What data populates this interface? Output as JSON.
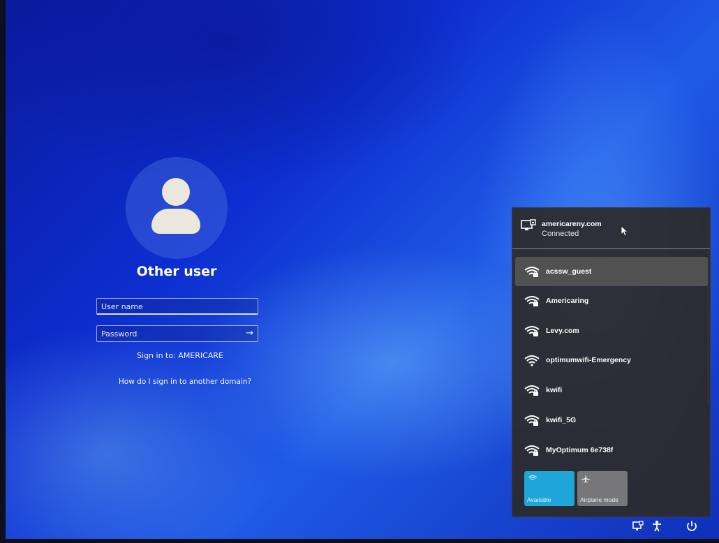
{
  "login": {
    "title": "Other user",
    "username_placeholder": "User name",
    "password_placeholder": "Password",
    "sign_in_to": "Sign in to: AMERICARE",
    "domain_help": "How do I sign in to another domain?"
  },
  "network_flyout": {
    "connected": {
      "name": "americareny.com",
      "status": "Connected",
      "icon": "ethernet-icon"
    },
    "networks": [
      {
        "name": "acssw_guest",
        "icon": "wifi-secured-icon"
      },
      {
        "name": "Americaring",
        "icon": "wifi-secured-icon"
      },
      {
        "name": "Levy.com",
        "icon": "wifi-secured-icon"
      },
      {
        "name": "optimumwifi-Emergency",
        "icon": "wifi-icon"
      },
      {
        "name": "kwifi",
        "icon": "wifi-secured-icon"
      },
      {
        "name": "kwifi_5G",
        "icon": "wifi-secured-icon"
      },
      {
        "name": "MyOptimum 6e738f",
        "icon": "wifi-secured-icon"
      }
    ],
    "tiles": {
      "wifi_label": "Available",
      "airplane_label": "Airplane mode"
    }
  },
  "tray": {
    "icons": [
      "network-icon",
      "accessibility-icon",
      "power-icon"
    ]
  },
  "colors": {
    "wifi_tile": "#1ea6d8",
    "airplane_tile": "#77777a",
    "flyout_bg": "#2c2a28"
  }
}
